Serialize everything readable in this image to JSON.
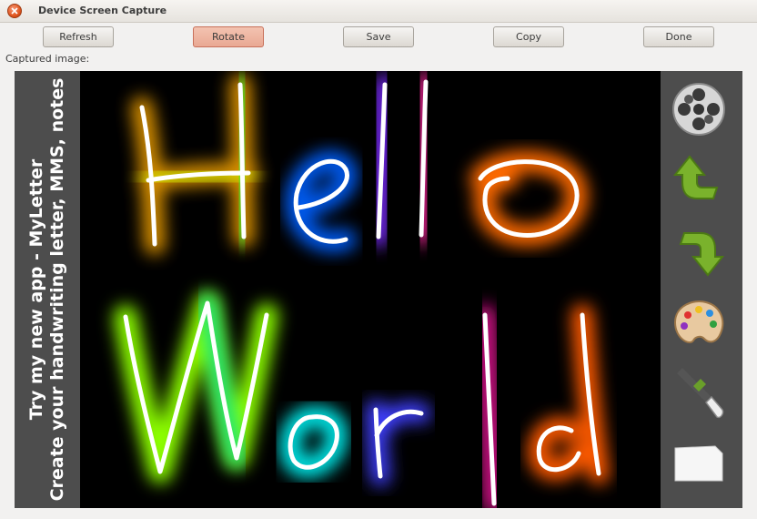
{
  "window": {
    "title": "Device Screen Capture"
  },
  "toolbar": {
    "refresh": "Refresh",
    "rotate": "Rotate",
    "save": "Save",
    "copy": "Copy",
    "done": "Done"
  },
  "caption": "Captured image:",
  "device": {
    "promo_line1": "Try my new app - MyLetter",
    "promo_line2": "Create your handwriting letter, MMS, notes",
    "drawing_text": "Hello World",
    "tools": [
      "film-reel-icon",
      "redo-arrow-icon",
      "undo-arrow-icon",
      "palette-icon",
      "brush-icon",
      "blank-page-icon"
    ]
  },
  "colors": {
    "active_button": "#e9a893",
    "screen_bg": "#000000",
    "side_bar": "#4d4d4d"
  }
}
